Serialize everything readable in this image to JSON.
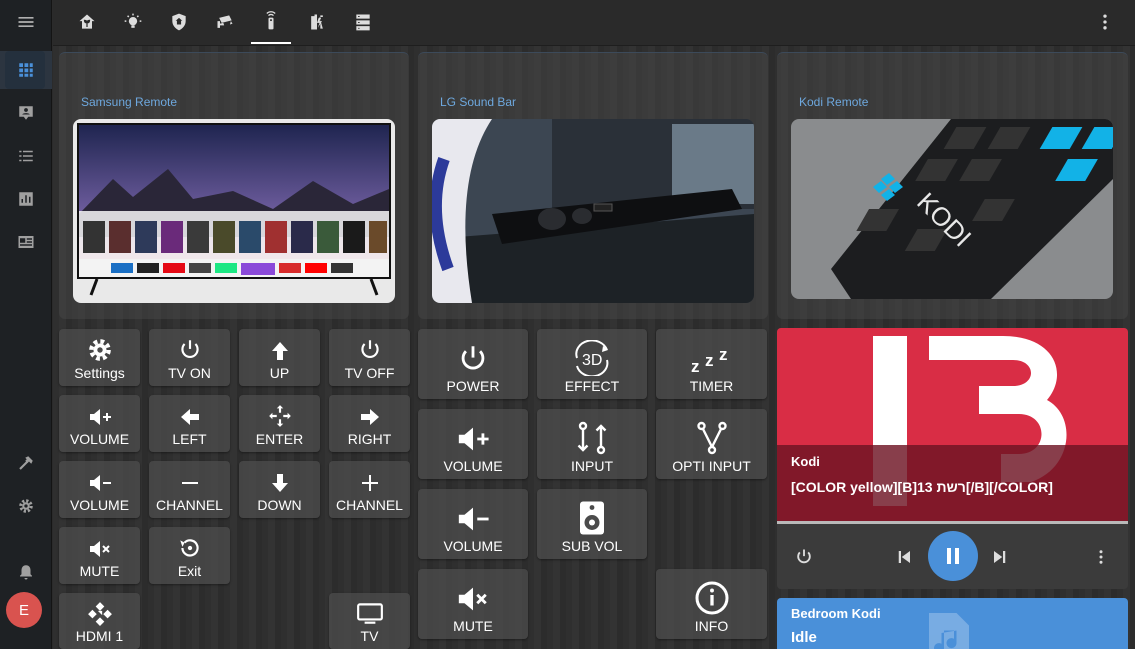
{
  "sidebar": {
    "items": [
      {
        "icon": "menu-icon"
      },
      {
        "icon": "grid-icon"
      },
      {
        "icon": "person-card-icon"
      },
      {
        "icon": "list-icon"
      },
      {
        "icon": "chart-icon"
      },
      {
        "icon": "newspaper-icon"
      },
      {
        "icon": "hammer-icon"
      },
      {
        "icon": "gear-icon"
      },
      {
        "icon": "bell-icon"
      }
    ],
    "avatar_letter": "E",
    "avatar_color": "#d9534f"
  },
  "topbar": {
    "tabs": [
      {
        "icon": "home-plant-icon"
      },
      {
        "icon": "lightbulb-icon"
      },
      {
        "icon": "shield-home-icon"
      },
      {
        "icon": "cctv-icon"
      },
      {
        "icon": "remote-icon",
        "selected": true
      },
      {
        "icon": "battery-charging-icon"
      },
      {
        "icon": "server-icon"
      }
    ],
    "menu_icon": "dots-vertical-icon"
  },
  "cards": {
    "samsung": {
      "title": "Samsung Remote"
    },
    "lg": {
      "title": "LG Sound Bar"
    },
    "kodi": {
      "title": "Kodi Remote"
    }
  },
  "samsung_buttons": {
    "settings": "Settings",
    "tv_on": "TV ON",
    "up": "UP",
    "tv_off": "TV OFF",
    "volume_up": "VOLUME",
    "left": "LEFT",
    "enter": "ENTER",
    "right": "RIGHT",
    "volume_down": "VOLUME",
    "channel_down": "CHANNEL",
    "down": "DOWN",
    "channel_up": "CHANNEL",
    "mute": "MUTE",
    "exit": "Exit",
    "hdmi1": "HDMI 1",
    "tv": "TV"
  },
  "lg_buttons": {
    "power": "POWER",
    "effect": "EFFECT",
    "timer": "TIMER",
    "volume_up": "VOLUME",
    "input": "INPUT",
    "opti_input": "OPTI INPUT",
    "volume_down": "VOLUME",
    "sub_vol": "SUB VOL",
    "mute": "MUTE",
    "info": "INFO"
  },
  "media_player": {
    "art_text": "13",
    "name": "Kodi",
    "title": "[COLOR yellow][B]13 רשת[/B][/COLOR]",
    "state": "playing",
    "accent": "#d92d45"
  },
  "bedroom": {
    "name": "Bedroom Kodi",
    "state": "Idle",
    "color": "#4a90d9"
  }
}
